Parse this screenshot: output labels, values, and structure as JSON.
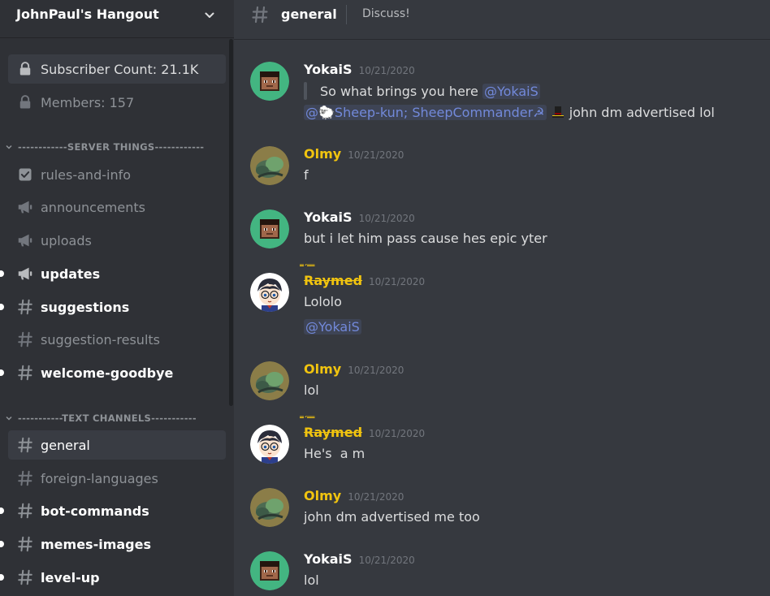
{
  "server": {
    "name": "JohnPaul's Hangout"
  },
  "stats": [
    {
      "label": "Subscriber Count: 21.1K"
    },
    {
      "label": "Members: 157"
    }
  ],
  "categories": [
    {
      "label": "------------SERVER THINGS------------"
    },
    {
      "label": "-----------TEXT CHANNELS-----------"
    }
  ],
  "channels": [
    {
      "label": "rules-and-info",
      "icon": "rules-check-icon",
      "unread": false
    },
    {
      "label": "announcements",
      "icon": "megaphone-icon",
      "unread": false
    },
    {
      "label": "uploads",
      "icon": "megaphone-icon",
      "unread": false
    },
    {
      "label": "updates",
      "icon": "megaphone-icon",
      "unread": true
    },
    {
      "label": "suggestions",
      "icon": "hash-icon",
      "unread": true
    },
    {
      "label": "suggestion-results",
      "icon": "hash-icon",
      "unread": false
    },
    {
      "label": "welcome-goodbye",
      "icon": "hash-icon",
      "unread": true
    },
    {
      "label": "general",
      "icon": "hash-icon",
      "unread": false,
      "active": true
    },
    {
      "label": "foreign-languages",
      "icon": "hash-icon",
      "unread": false
    },
    {
      "label": "bot-commands",
      "icon": "hash-icon",
      "unread": true
    },
    {
      "label": "memes-images",
      "icon": "hash-icon",
      "unread": true
    },
    {
      "label": "level-up",
      "icon": "hash-icon",
      "unread": true
    }
  ],
  "header": {
    "channel": "general",
    "topic": "Discuss!"
  },
  "colors": {
    "sidebar": "#2f3136",
    "chat": "#36393f",
    "mention": "#7289da",
    "olmy": "#f1c40f",
    "raymed": "#f1c40f"
  },
  "messages": [
    {
      "author": "YokaiS",
      "timestamp": "10/21/2020",
      "quote_text": "So what brings you here ",
      "quote_mention": "@YokaiS",
      "reply_mention": "@🐑Sheep-kun; SheepCommander☭",
      "reply_text": " john dm advertised lol"
    },
    {
      "author": "Olmy",
      "timestamp": "10/21/2020",
      "text": "f"
    },
    {
      "author": "YokaiS",
      "timestamp": "10/21/2020",
      "text": "but i let him pass cause hes epic yter"
    },
    {
      "author": "Raymed",
      "author_decoration": "̿̿ ́ ̿ ̿",
      "timestamp": "10/21/2020",
      "text": "Lololo",
      "mention": "@YokaiS"
    },
    {
      "author": "Olmy",
      "timestamp": "10/21/2020",
      "text": "lol"
    },
    {
      "author": "Raymed",
      "author_decoration": "̿̿ ́ ̿ ̿",
      "timestamp": "10/21/2020",
      "text": "He's  a m"
    },
    {
      "author": "Olmy",
      "timestamp": "10/21/2020",
      "text": "john dm advertised me too"
    },
    {
      "author": "YokaiS",
      "timestamp": "10/21/2020",
      "text": "lol"
    }
  ]
}
